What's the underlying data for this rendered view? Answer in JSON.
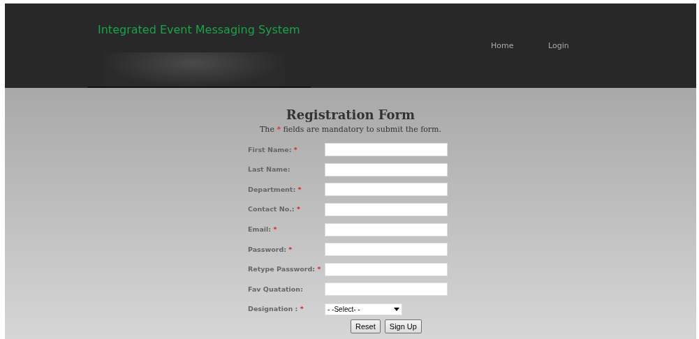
{
  "header": {
    "title": "Integrated Event Messaging System",
    "nav": [
      {
        "label": "Home"
      },
      {
        "label": "Login"
      }
    ]
  },
  "form": {
    "title": "Registration Form",
    "note": {
      "before": "The ",
      "mark": "*",
      "after": " fields are mandatory to submit the form."
    },
    "fields": [
      {
        "kind": "text",
        "label": "First Name:",
        "mark": "*"
      },
      {
        "kind": "text",
        "label": "Last Name:"
      },
      {
        "kind": "text",
        "label": "Department:",
        "mark": "*"
      },
      {
        "kind": "text",
        "label": "Contact No.:",
        "mark": "*"
      },
      {
        "kind": "text",
        "label": "Email:",
        "mark": "*"
      },
      {
        "kind": "password",
        "label": "Password:",
        "mark": "*"
      },
      {
        "kind": "password",
        "label": "Retype Password:",
        "mark": "*"
      },
      {
        "kind": "text",
        "label": "Fav Quatation:"
      },
      {
        "kind": "select",
        "label": "Designation :",
        "mark": "*",
        "value": "- -Select- -"
      }
    ],
    "buttons": [
      "Reset",
      "Sign Up"
    ]
  }
}
